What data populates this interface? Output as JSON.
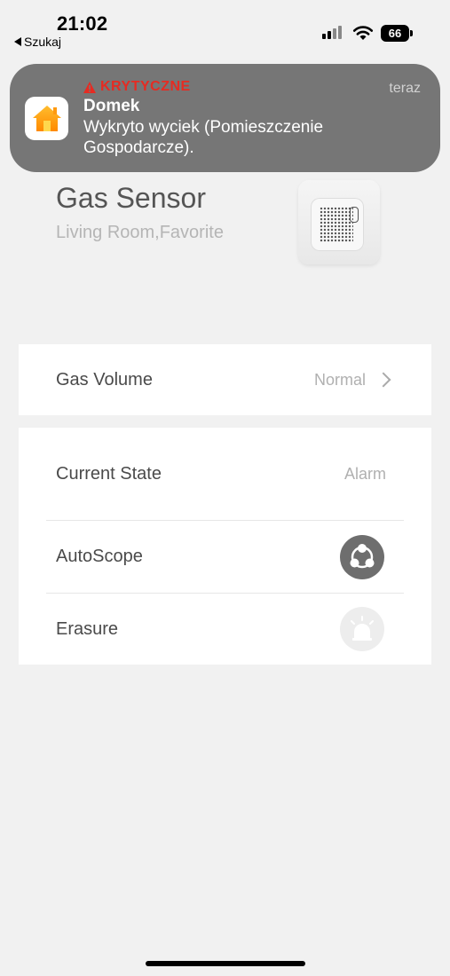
{
  "status_bar": {
    "time": "21:02",
    "back_label": "Szukaj",
    "battery": "66"
  },
  "notification": {
    "level": "KRYTYCZNE",
    "app_name": "Domek",
    "message": "Wykryto wyciek (Pomieszczenie Gospodarcze).",
    "time": "teraz",
    "accent_color": "#e62b22"
  },
  "device": {
    "title": "Gas Sensor",
    "subtitle": "Living Room,Favorite"
  },
  "gas_volume": {
    "label": "Gas Volume",
    "value": "Normal"
  },
  "status_list": {
    "current_state_label": "Current State",
    "current_state_value": "Alarm",
    "autoscope_label": "AutoScope",
    "erasure_label": "Erasure"
  }
}
